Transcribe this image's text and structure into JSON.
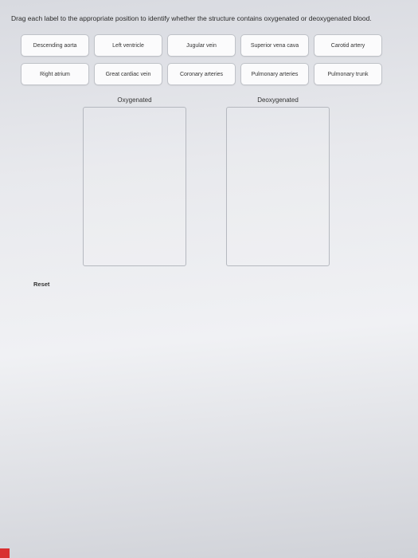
{
  "instruction": "Drag each label to the appropriate position to identify whether the structure contains oxygenated or deoxygenated blood.",
  "labels_row1": [
    "Descending aorta",
    "Left ventricle",
    "Jugular vein",
    "Superior vena cava",
    "Carotid artery"
  ],
  "labels_row2": [
    "Right atrium",
    "Great cardiac vein",
    "Coronary arteries",
    "Pulmonary arteries",
    "Pulmonary trunk"
  ],
  "dropzones": {
    "left_title": "Oxygenated",
    "right_title": "Deoxygenated"
  },
  "reset_label": "Reset"
}
